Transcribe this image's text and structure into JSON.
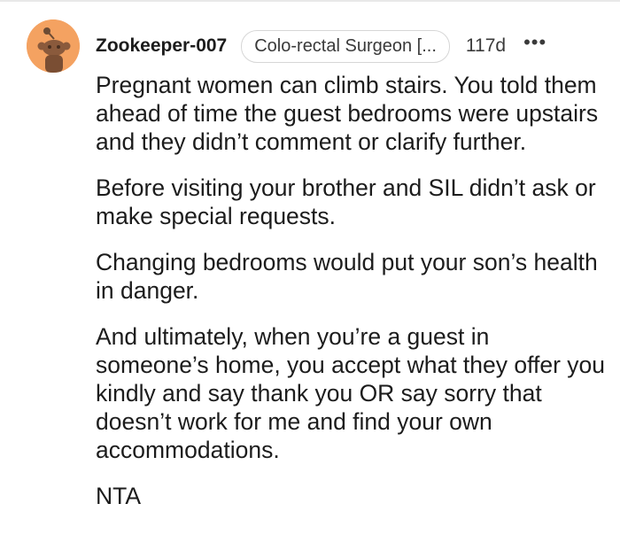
{
  "comment": {
    "username": "Zookeeper-007",
    "flair": "Colo-rectal Surgeon [...",
    "timestamp": "117d",
    "more_label": "•••",
    "avatar": {
      "icon": "snoo-avatar-icon",
      "background": "#f4a261"
    },
    "paragraphs": [
      "Pregnant women can climb stairs. You told them ahead of time the guest bedrooms were upstairs and they didn’t comment or clarify further.",
      "Before visiting your brother and SIL didn’t ask or make special requests.",
      "Changing bedrooms would put your son’s health in danger.",
      "And ultimately, when you’re a guest in someone’s home, you accept what they offer you kindly and say thank you OR say sorry that doesn’t work for me and find your own accommodations.",
      "NTA"
    ]
  }
}
